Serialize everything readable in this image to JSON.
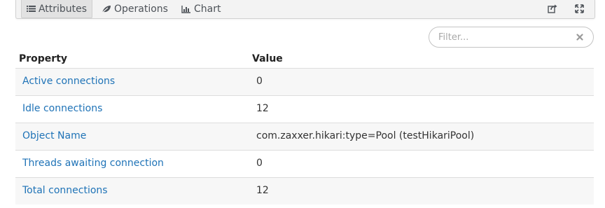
{
  "tabs": {
    "attributes": "Attributes",
    "operations": "Operations",
    "chart": "Chart"
  },
  "toolbar": {
    "export_icon": "share-icon",
    "expand_icon": "expand-icon"
  },
  "filter": {
    "placeholder": "Filter...",
    "value": ""
  },
  "table": {
    "headers": {
      "property": "Property",
      "value": "Value"
    },
    "rows": [
      {
        "property": "Active connections",
        "value": "0"
      },
      {
        "property": "Idle connections",
        "value": "12"
      },
      {
        "property": "Object Name",
        "value": "com.zaxxer.hikari:type=Pool (testHikariPool)"
      },
      {
        "property": "Threads awaiting connection",
        "value": "0"
      },
      {
        "property": "Total connections",
        "value": "12"
      }
    ]
  },
  "colors": {
    "link": "#1f73b7",
    "stripe": "#f7f7f7",
    "border": "#dddddd"
  }
}
